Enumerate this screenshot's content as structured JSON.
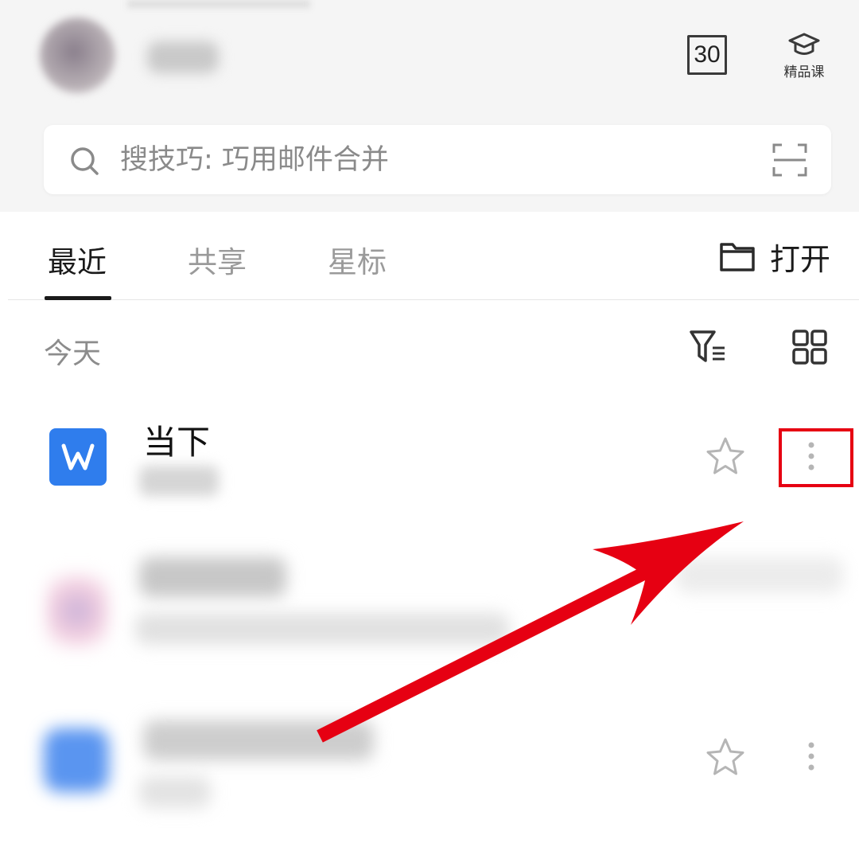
{
  "header": {
    "calendar_day": "30",
    "course_label": "精品课"
  },
  "search": {
    "placeholder": "搜技巧: 巧用邮件合并"
  },
  "tabs": [
    {
      "label": "最近",
      "active": true
    },
    {
      "label": "共享",
      "active": false
    },
    {
      "label": "星标",
      "active": false
    }
  ],
  "open_button": {
    "label": "打开"
  },
  "section": {
    "label": "今天"
  },
  "files": [
    {
      "name": "当下",
      "icon": "word-doc-icon",
      "icon_letter": "W"
    }
  ],
  "colors": {
    "accent": "#2f7ded",
    "annotation": "#e60012",
    "header_bg": "#f5f5f5"
  }
}
